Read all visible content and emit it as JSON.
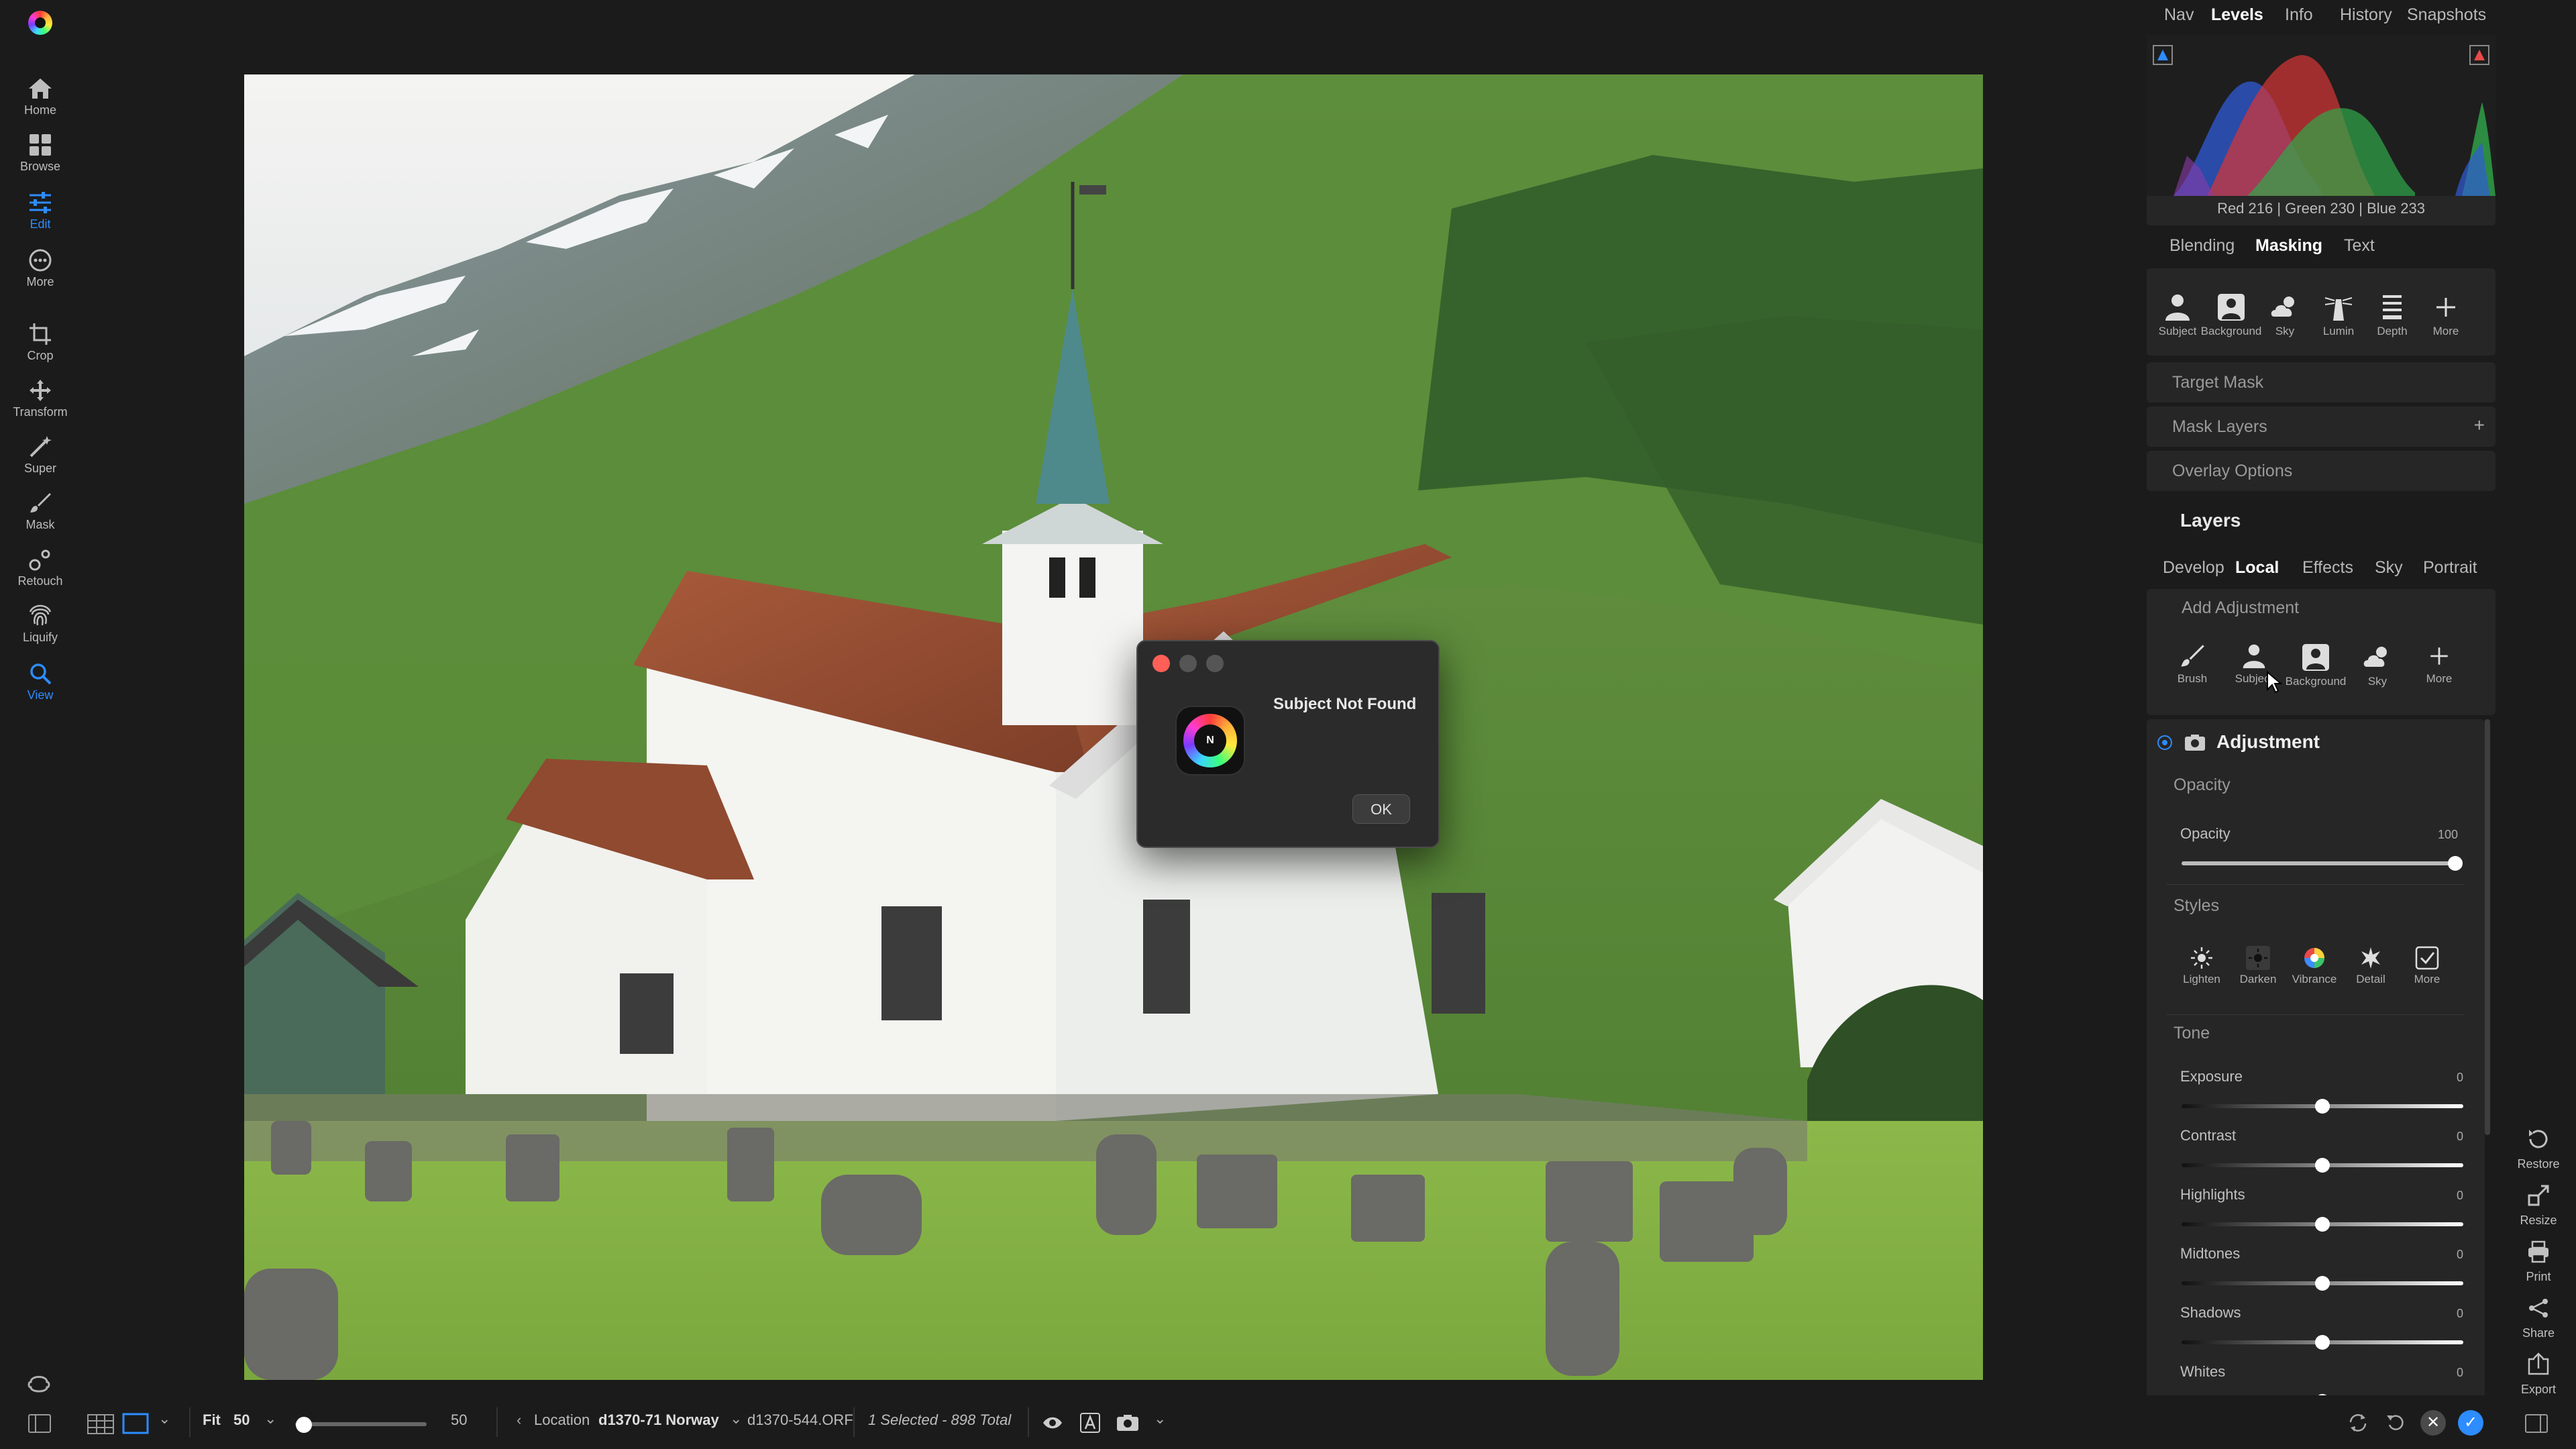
{
  "app": {
    "logo_icon": "luminar-neo-logo"
  },
  "left_toolbar": {
    "items": [
      {
        "label": "Home",
        "icon": "home-icon"
      },
      {
        "label": "Browse",
        "icon": "grid-icon"
      },
      {
        "label": "Edit",
        "icon": "sliders-icon",
        "active": true
      },
      {
        "label": "More",
        "icon": "ellipsis-icon"
      },
      {
        "label": "Crop",
        "icon": "crop-icon"
      },
      {
        "label": "Transform",
        "icon": "move-icon"
      },
      {
        "label": "Super",
        "icon": "magic-wand-icon"
      },
      {
        "label": "Mask",
        "icon": "brush-icon"
      },
      {
        "label": "Retouch",
        "icon": "retouch-icon"
      },
      {
        "label": "Liquify",
        "icon": "fingerprint-icon"
      },
      {
        "label": "View",
        "icon": "zoom-icon",
        "active": true
      }
    ]
  },
  "top_tabs": {
    "items": [
      "Nav",
      "Levels",
      "Info",
      "History",
      "Snapshots"
    ],
    "active": "Levels"
  },
  "histogram": {
    "readout": "Red 216 | Green 230 | Blue 233"
  },
  "mask_tabs": {
    "items": [
      "Blending",
      "Masking",
      "Text"
    ],
    "active": "Masking"
  },
  "mask_tools": [
    {
      "label": "Subject",
      "icon": "person-icon"
    },
    {
      "label": "Background",
      "icon": "person-square-icon"
    },
    {
      "label": "Sky",
      "icon": "cloud-sun-icon"
    },
    {
      "label": "Lumin",
      "icon": "lighthouse-icon"
    },
    {
      "label": "Depth",
      "icon": "layers-icon"
    },
    {
      "label": "More",
      "icon": "plus-icon"
    }
  ],
  "mask_sections": {
    "target_mask": "Target Mask",
    "mask_layers": "Mask Layers",
    "overlay_options": "Overlay Options"
  },
  "layers": {
    "title": "Layers",
    "tabs": [
      "Develop",
      "Local",
      "Effects",
      "Sky",
      "Portrait"
    ],
    "active_tab": "Local",
    "add_adjustment": "Add Adjustment",
    "tools": [
      {
        "label": "Brush",
        "icon": "brush-icon"
      },
      {
        "label": "Subject",
        "icon": "person-icon"
      },
      {
        "label": "Background",
        "icon": "person-square-icon"
      },
      {
        "label": "Sky",
        "icon": "cloud-sun-icon"
      },
      {
        "label": "More",
        "icon": "plus-icon"
      }
    ]
  },
  "adjustment": {
    "title": "Adjustment",
    "opacity_section": "Opacity",
    "opacity": {
      "label": "Opacity",
      "value": "100",
      "fraction": 1.0
    },
    "styles_section": "Styles",
    "styles": [
      {
        "label": "Lighten",
        "icon": "sun-icon"
      },
      {
        "label": "Darken",
        "icon": "sun-dark-icon"
      },
      {
        "label": "Vibrance",
        "icon": "color-wheel-icon"
      },
      {
        "label": "Detail",
        "icon": "starburst-icon"
      },
      {
        "label": "More",
        "icon": "checkbox-icon"
      }
    ],
    "tone_section": "Tone",
    "tone_sliders": [
      {
        "label": "Exposure",
        "value": "0",
        "fraction": 0.5
      },
      {
        "label": "Contrast",
        "value": "0",
        "fraction": 0.5
      },
      {
        "label": "Highlights",
        "value": "0",
        "fraction": 0.5
      },
      {
        "label": "Midtones",
        "value": "0",
        "fraction": 0.5
      },
      {
        "label": "Shadows",
        "value": "0",
        "fraction": 0.5
      },
      {
        "label": "Whites",
        "value": "0",
        "fraction": 0.5
      }
    ]
  },
  "right_actions": [
    {
      "label": "Restore",
      "icon": "restore-icon"
    },
    {
      "label": "Resize",
      "icon": "resize-icon"
    },
    {
      "label": "Print",
      "icon": "printer-icon"
    },
    {
      "label": "Share",
      "icon": "share-icon"
    },
    {
      "label": "Export",
      "icon": "export-icon"
    }
  ],
  "dialog": {
    "title": "Subject Not Found",
    "ok_label": "OK",
    "icon_text": "N"
  },
  "bottom_bar": {
    "fit_label": "Fit",
    "zoom_value": "50",
    "zoom_slider_value": "50",
    "zoom_fraction": 0.0,
    "location_label": "Location",
    "folder": "d1370-71 Norway",
    "filename": "d1370-544.ORF",
    "selection": "1 Selected - 898 Total"
  },
  "colors": {
    "accent": "#2d8cff",
    "close": "#fe5f57"
  }
}
